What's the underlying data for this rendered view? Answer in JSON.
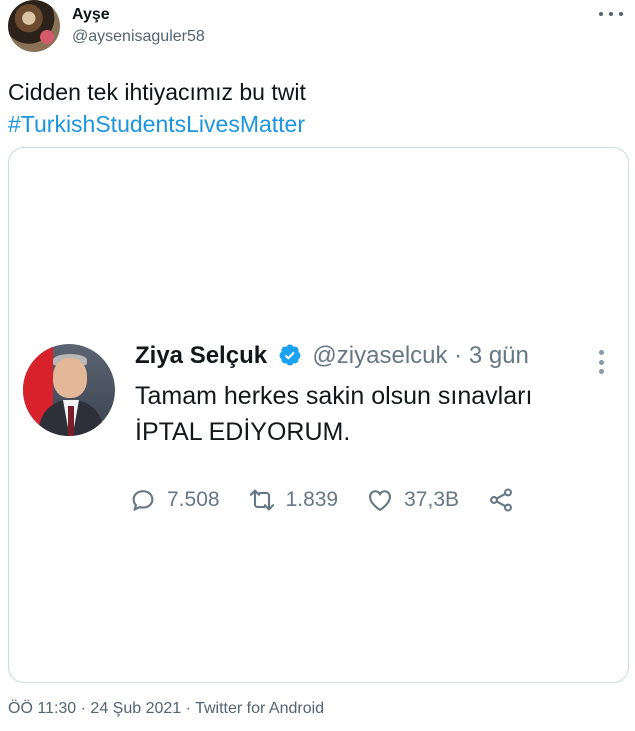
{
  "author": {
    "name": "Ayşe",
    "handle": "@aysenisaguler58"
  },
  "tweet": {
    "text": "Cidden tek ihtiyacımız bu twit",
    "hashtag": "#TurkishStudentsLivesMatter"
  },
  "embedded": {
    "name": "Ziya Selçuk",
    "handle_time": "@ziyaselcuk · 3 gün",
    "text_line1": "Tamam herkes sakin olsun sınavları",
    "text_line2": "İPTAL EDİYORUM.",
    "replies": "7.508",
    "retweets": "1.839",
    "likes": "37,3B"
  },
  "meta": {
    "time": "ÖÖ 11:30",
    "date": "24 Şub 2021",
    "source": "Twitter for Android"
  },
  "colors": {
    "link": "#1b95e0",
    "verified": "#1da1f2",
    "muted": "#536471",
    "border": "#cfd9de"
  },
  "icons": [
    "more-icon",
    "verified-icon",
    "reply-icon",
    "retweet-icon",
    "like-icon",
    "share-icon"
  ]
}
